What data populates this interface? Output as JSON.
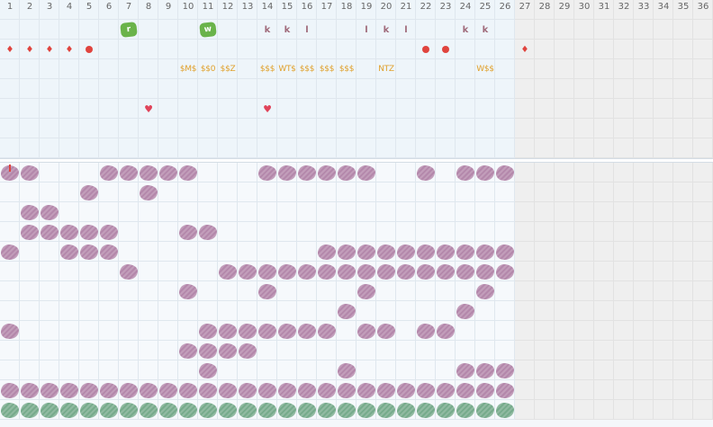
{
  "column_numbers": [
    "1",
    "2",
    "3",
    "4",
    "5",
    "6",
    "7",
    "8",
    "9",
    "10",
    "11",
    "12",
    "13",
    "14",
    "15",
    "16",
    "17",
    "18",
    "19",
    "20",
    "21",
    "22",
    "23",
    "24",
    "25",
    "26",
    "27",
    "28",
    "29",
    "30",
    "31",
    "32",
    "33",
    "34",
    "35",
    "36"
  ],
  "active_columns": 26,
  "colors": {
    "purple_block": "#b488ab",
    "green_block": "#77ab8c",
    "badge": "#6ab34a",
    "letter": "#a06a7a",
    "money": "#e0a02a",
    "red": "#e0443e",
    "heart": "#e0445a",
    "grey_area": "#efefef"
  },
  "top_marks": [
    {
      "row": 1,
      "col": 7,
      "type": "badge",
      "text": "r"
    },
    {
      "row": 1,
      "col": 11,
      "type": "badge",
      "text": "w"
    },
    {
      "row": 1,
      "col": 14,
      "type": "letter",
      "text": "k"
    },
    {
      "row": 1,
      "col": 15,
      "type": "letter",
      "text": "k"
    },
    {
      "row": 1,
      "col": 16,
      "type": "letter",
      "text": "l"
    },
    {
      "row": 1,
      "col": 19,
      "type": "letter",
      "text": "l"
    },
    {
      "row": 1,
      "col": 20,
      "type": "letter",
      "text": "k"
    },
    {
      "row": 1,
      "col": 21,
      "type": "letter",
      "text": "l"
    },
    {
      "row": 1,
      "col": 24,
      "type": "letter",
      "text": "k"
    },
    {
      "row": 1,
      "col": 25,
      "type": "letter",
      "text": "k"
    },
    {
      "row": 2,
      "col": 1,
      "type": "drop",
      "text": "♦"
    },
    {
      "row": 2,
      "col": 2,
      "type": "drop",
      "text": "♦"
    },
    {
      "row": 2,
      "col": 3,
      "type": "drop",
      "text": "♦"
    },
    {
      "row": 2,
      "col": 4,
      "type": "drop",
      "text": "♦"
    },
    {
      "row": 2,
      "col": 5,
      "type": "dot",
      "text": ""
    },
    {
      "row": 2,
      "col": 22,
      "type": "dot",
      "text": ""
    },
    {
      "row": 2,
      "col": 23,
      "type": "dot",
      "text": ""
    },
    {
      "row": 2,
      "col": 27,
      "type": "drop",
      "text": "♦"
    },
    {
      "row": 3,
      "col": 10,
      "type": "money",
      "text": "$M$"
    },
    {
      "row": 3,
      "col": 11,
      "type": "money",
      "text": "$$0"
    },
    {
      "row": 3,
      "col": 12,
      "type": "money",
      "text": "$$Z"
    },
    {
      "row": 3,
      "col": 14,
      "type": "money",
      "text": "$$$"
    },
    {
      "row": 3,
      "col": 15,
      "type": "money",
      "text": "WT$"
    },
    {
      "row": 3,
      "col": 16,
      "type": "money",
      "text": "$$$"
    },
    {
      "row": 3,
      "col": 17,
      "type": "money",
      "text": "$$$"
    },
    {
      "row": 3,
      "col": 18,
      "type": "money",
      "text": "$$$"
    },
    {
      "row": 3,
      "col": 20,
      "type": "money",
      "text": "NTZ"
    },
    {
      "row": 3,
      "col": 25,
      "type": "money",
      "text": "W$$"
    },
    {
      "row": 5,
      "col": 8,
      "type": "heart",
      "text": "♥"
    },
    {
      "row": 5,
      "col": 14,
      "type": "heart",
      "text": "♥"
    },
    {
      "row": 8,
      "col": 1,
      "type": "bar",
      "text": ""
    }
  ],
  "block_rows": [
    "#....#####...#######..#.#####",
    "........#.#................",
    ".##........................",
    ".#####...##................",
    "#..####.........###########",
    "......#....#################",
    ".........#...#....#......#.",
    ".................#.....#...",
    "#.........########.##.##...",
    ".........####..............",
    "..........#......#.....###.",
    "##########################.",
    "GGGGGGGGGGGGGGGGGGGGGGGGGG."
  ],
  "fixed_block_rows": [
    "##...#####...######..#.#####",
    "....#..#..................",
    ".##.......................",
    ".#####...##...............",
    "#..###..........##########",
    "......#....###############",
    ".........#...#....#.....#.",
    ".................#.....#..",
    "#.........#######.##.##...",
    ".........####.............",
    "..........#......#.....###",
    "##########################",
    "GGGGGGGGGGGGGGGGGGGGGGGGGG"
  ]
}
